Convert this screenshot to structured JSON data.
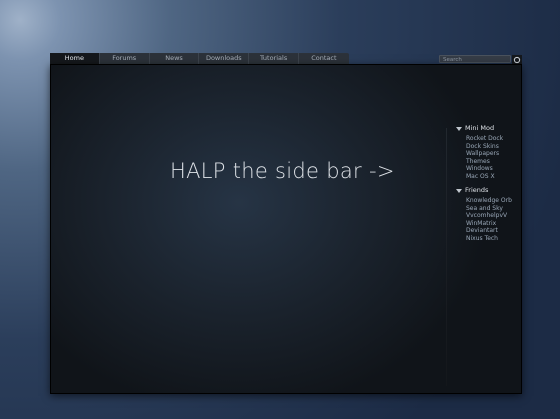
{
  "nav": {
    "tabs": [
      {
        "label": "Home",
        "name": "tab-home",
        "active": true
      },
      {
        "label": "Forums",
        "name": "tab-forums"
      },
      {
        "label": "News",
        "name": "tab-news"
      },
      {
        "label": "Downloads",
        "name": "tab-downloads"
      },
      {
        "label": "Tutorials",
        "name": "tab-tutorials"
      },
      {
        "label": "Contact",
        "name": "tab-contact"
      }
    ]
  },
  "search": {
    "placeholder": "Search",
    "button_icon": "search-icon"
  },
  "main": {
    "headline": "HALP the side bar ->"
  },
  "sidebar": {
    "sections": [
      {
        "title": "Mini Mod",
        "icon": "triangle-down-icon",
        "items": [
          "Rocket Dock",
          "Dock Skins",
          "Wallpapers",
          "Themes",
          "Windows",
          "Mac OS X"
        ]
      },
      {
        "title": "Friends",
        "icon": "triangle-down-icon",
        "items": [
          "Knowledge Orb",
          "Sea and Sky",
          "VvcomhelpvV",
          "WinMatrix",
          "Deviantart",
          "Nixus Tech"
        ]
      }
    ]
  },
  "colors": {
    "panel": "#1a222c",
    "background": "#2b3e5b",
    "link": "#9aa8b8",
    "text": "#dfe3e8"
  }
}
